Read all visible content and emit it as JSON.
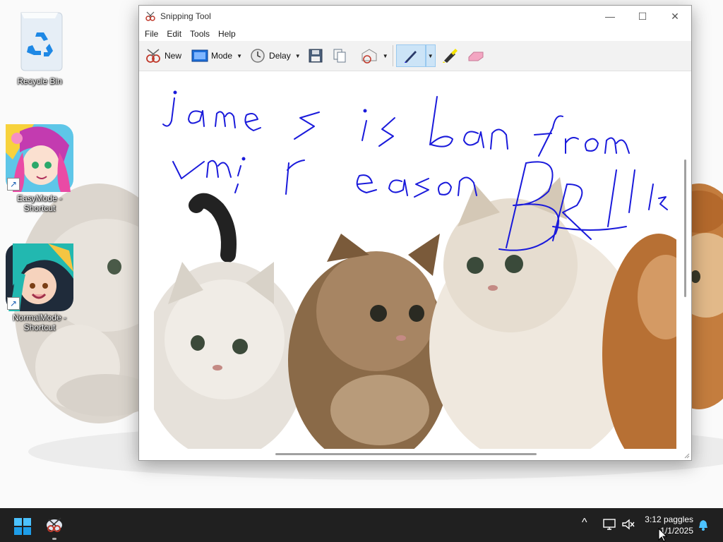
{
  "desktop": {
    "icons": [
      {
        "label": "Recycle Bin"
      },
      {
        "label": "EasyMode - Shortcut"
      },
      {
        "label": "NormalMode - Shortcut"
      }
    ]
  },
  "window": {
    "title": "Snipping Tool",
    "controls": {
      "minimize": "—",
      "maximize": "☐",
      "close": "✕"
    },
    "menu": [
      "File",
      "Edit",
      "Tools",
      "Help"
    ],
    "toolbar": {
      "new_label": "New",
      "mode_label": "Mode",
      "delay_label": "Delay"
    },
    "annotation": {
      "line1": "james is ban from",
      "line2": "vmi reason",
      "line3": "BRI",
      "line4": "Ish",
      "ink_color": "#1a1adb"
    }
  },
  "taskbar": {
    "clock_time": "3:12 paggles",
    "clock_date": "1/1/2025",
    "tray_chevron": "^"
  },
  "colors": {
    "taskbar": "#202020",
    "accent": "#0078d4",
    "pen_active_bg": "#cce4f7"
  },
  "icons": [
    "recycle-bin-icon",
    "shortcut-arrow-icon",
    "snipping-tool-icon",
    "windows-start-icon",
    "pen-icon",
    "highlighter-icon",
    "eraser-icon",
    "save-icon",
    "copy-icon",
    "send-icon",
    "notification-bell-icon"
  ]
}
